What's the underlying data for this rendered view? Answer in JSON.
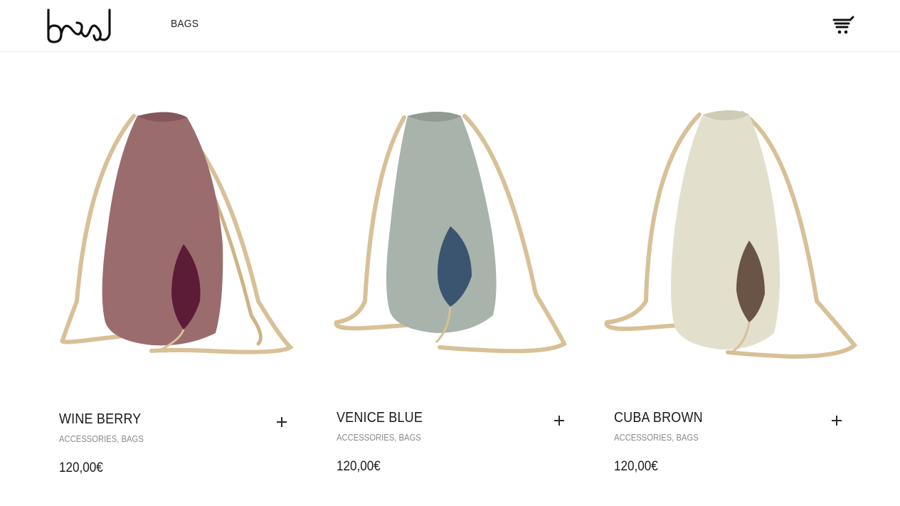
{
  "header": {
    "logo_alt": "band",
    "nav": [
      {
        "label": "BAGS"
      }
    ],
    "cart_icon": "cart-icon"
  },
  "products": [
    {
      "title": "WINE BERRY",
      "categories": [
        "ACCESSORIES",
        "BAGS"
      ],
      "category_sep": ", ",
      "price": "120,00€",
      "colors": {
        "body": "#9a6c6e",
        "inner": "#5c1b36",
        "rope": "#d8c097"
      },
      "add_icon": "plus-icon"
    },
    {
      "title": "VENICE BLUE",
      "categories": [
        "ACCESSORIES",
        "BAGS"
      ],
      "category_sep": ", ",
      "price": "120,00€",
      "colors": {
        "body": "#a7b3ab",
        "inner": "#3b5470",
        "rope": "#d8c097"
      },
      "add_icon": "plus-icon"
    },
    {
      "title": "CUBA BROWN",
      "categories": [
        "ACCESSORIES",
        "BAGS"
      ],
      "category_sep": ", ",
      "price": "120,00€",
      "colors": {
        "body": "#e2dfcd",
        "inner": "#6a5446",
        "rope": "#d8c097"
      },
      "add_icon": "plus-icon"
    }
  ]
}
